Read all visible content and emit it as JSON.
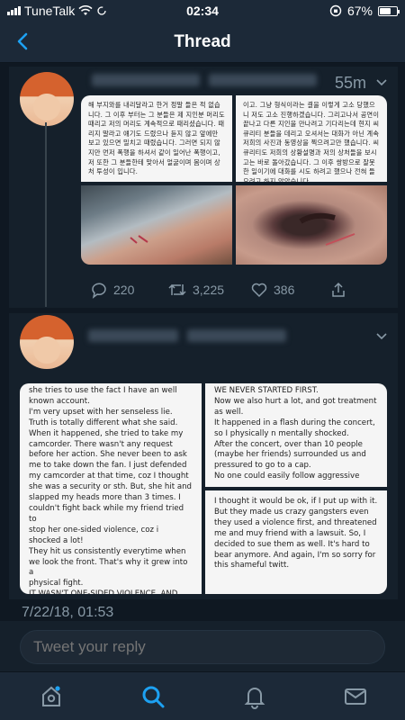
{
  "status_bar": {
    "carrier": "TuneTalk",
    "time": "02:34",
    "battery": "67%"
  },
  "navbar": {
    "title": "Thread"
  },
  "tweet1": {
    "time": "55m",
    "replies": "220",
    "retweets": "3,225",
    "likes": "386",
    "image_left_text": "해 부지와를 내리달라고 한거 정말 들은 적 없습니다. 그 이후 부터는 그 분들은 제 지인분 머리도 때리고 저의 머리도 계속적으로 때리셨습니다. 때리지 말라고 얘기도 드렸으나 듣지 않고 앞에만 보고 있으면 밀치고 때렸습니다. 그러면 되지 않지만 먼저 폭행을 하셔서 같이 일어난 폭행이고, 저 또한 그 분들한테 맞아서 얼굴이며 몸이며 상처 투성이 입니다.",
    "image_right_text": "이고. 그냥 형식이라는 결을 이렇게 고소 당했으니 저도 고소 진행하겠습니다. 그리고나서 공연이 끝나고 다른 지인을 만나려고 기다리는데 현지 씨큐리티 분들을 데리고 오셔서는 대화가 아닌 계속 저희의 사진과 동영상을 찍으려고만 했습니다. 씨큐리티도 저희의 상황설명과 저의 상처들을 보시고는 바로 돌아갔습니다. 그 이후 쌍방으로 잘못한 일이기에 대화를 시도 하려고 했으나 전혀 들으려고 하지 않았습니다."
  },
  "tweet2": {
    "image_left_lines": [
      "she tries to use the fact I have an well",
      "known account.",
      "I'm very upset with her senseless  lie.",
      "Truth is totally different what she said.",
      "When it happened, she tried to take my",
      "camcorder. There wasn't any request",
      "before her action. She never been to ask",
      "me to take down the fan. I just defended",
      "my camcorder at that time, coz I thought",
      "she was a security or sth. But, she hit and",
      "slapped my heads more than 3 times. I",
      "couldn't fight back while my friend tried to",
      "stop her one-sided violence, coz i",
      "shocked a lot!",
      "They hit us consistently everytime when",
      "we look the front. That's why it grew into a",
      "physical fight.",
      "IT WASN'T ONE-SIDED VIOLENCE, AND"
    ],
    "image_right_top_lines": [
      "WE NEVER STARTED FIRST.",
      "Now we also hurt a lot, and got treatment",
      "as well.",
      "It happened in a flash during the concert,",
      "so I physically n mentally shocked.",
      "After the concert, over than 10 people",
      "(maybe her friends) surrounded us and",
      "pressured to go to a cap.",
      "No one could easily follow aggressive"
    ],
    "image_right_bottom_lines": [
      "I thought it would be ok, if I put up with it.",
      "But they made us crazy gangsters even",
      "they used a violence first, and threatened",
      "me and muy friend with a lawsuit. So, I",
      "decided to sue them as well. It's hard to",
      "bear anymore. And again, I'm so sorry for",
      "this shameful twitt."
    ]
  },
  "timestamp": "7/22/18, 01:53",
  "reply": {
    "placeholder": "Tweet your reply"
  },
  "colors": {
    "accent": "#1da1f2",
    "background": "#15202b",
    "muted": "#8899a6"
  }
}
